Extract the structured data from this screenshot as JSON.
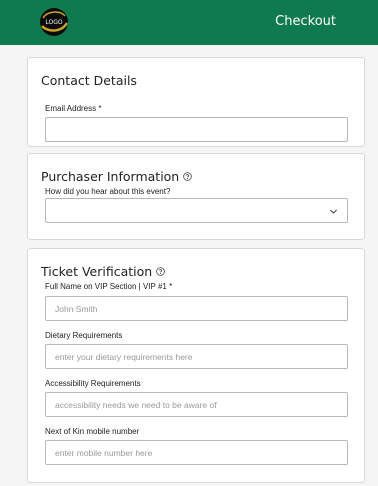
{
  "header": {
    "title": "Checkout",
    "logo_text": "LOGO"
  },
  "contact": {
    "title": "Contact Details",
    "email_label": "Email Address *",
    "email_value": ""
  },
  "purchaser": {
    "title": "Purchaser Information",
    "question_label": "How did you hear about this event?",
    "question_value": ""
  },
  "ticket": {
    "title": "Ticket Verification",
    "fullname_label": "Full Name on VIP Section | VIP #1 *",
    "fullname_placeholder": "John Smith",
    "dietary_label": "Dietary Requirements",
    "dietary_placeholder": "enter your dietary requirements here",
    "accessibility_label": "Accessibility Requirements",
    "accessibility_placeholder": "accessibility needs we need to be aware of",
    "kin_label": "Next of Kin mobile number",
    "kin_placeholder": "enter mobile number here"
  },
  "colors": {
    "brand": "#0e7a4e",
    "logo_gold": "#c9a227"
  }
}
